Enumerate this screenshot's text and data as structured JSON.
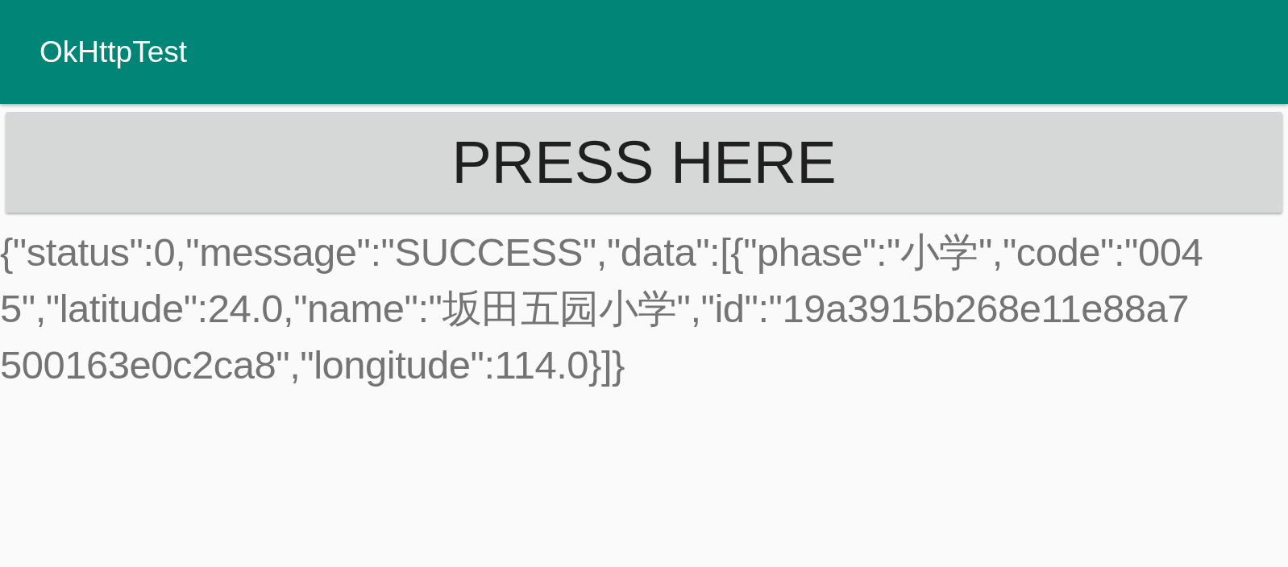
{
  "app_bar": {
    "title": "OkHttpTest"
  },
  "button": {
    "label": "PRESS HERE"
  },
  "response_text": "{\"status\":0,\"message\":\"SUCCESS\",\"data\":[{\"phase\":\"小学\",\"code\":\"0045\",\"latitude\":24.0,\"name\":\"坂田五园小学\",\"id\":\"19a3915b268e11e88a7500163e0c2ca8\",\"longitude\":114.0}]}"
}
